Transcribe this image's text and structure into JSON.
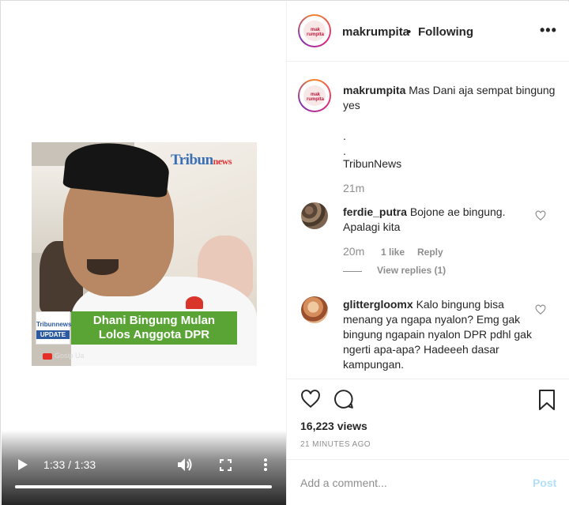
{
  "video": {
    "logo_text": "Tribun",
    "logo_suffix": "news",
    "banner_line1": "Dhani Bingung Mulan",
    "banner_line2": "Lolos Anggota DPR",
    "badge_text": "Tribunnews",
    "badge_update": "UPDATE",
    "watermark": "Gosip Ua",
    "time_display": "1:33 / 1:33",
    "progress": 1.0
  },
  "header": {
    "username": "makrumpita",
    "separator": "•",
    "follow_state": "Following",
    "more_label": "•••",
    "avatar_text": "mak rumpita"
  },
  "caption": {
    "username": "makrumpita",
    "text": "Mas Dani aja sempat bingung yes",
    "dot1": ".",
    "dot2": ".",
    "source": "TribunNews",
    "time": "21m"
  },
  "comments": [
    {
      "username": "ferdie_putra",
      "text": "Bojone ae bingung. Apalagi kita",
      "time": "20m",
      "likes": "1 like",
      "reply_label": "Reply",
      "view_replies": "View replies (1)"
    },
    {
      "username": "glittergloomx",
      "text": "Kalo bingung bisa menang ya ngapa nyalon? Emg gak bingung ngapain nyalon DPR pdhl gak ngerti apa-apa? Hadeeeh dasar kampungan."
    }
  ],
  "stats": {
    "views": "16,223 views",
    "timestamp": "21 MINUTES AGO"
  },
  "add_comment": {
    "placeholder": "Add a comment...",
    "post_label": "Post"
  },
  "colors": {
    "text": "#262626",
    "muted": "#8e8e8e",
    "post_disabled": "#b2dffc",
    "banner_green": "#5aa436"
  }
}
